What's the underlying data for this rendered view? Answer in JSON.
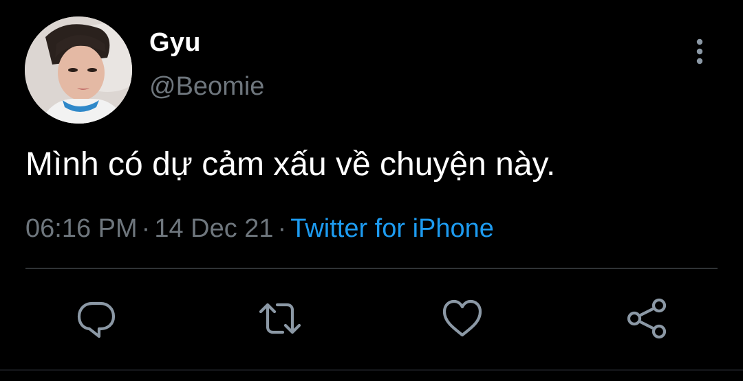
{
  "user": {
    "display_name": "Gyu",
    "handle": "@Beomie",
    "avatar_icon": "profile-photo"
  },
  "tweet": {
    "text": "Mình có dự cảm xấu về chuyện này.",
    "time": "06:16 PM",
    "separator": "·",
    "date": "14 Dec 21",
    "source": "Twitter for iPhone"
  },
  "header": {
    "more_icon": "more-vertical-icon"
  },
  "actions": [
    {
      "name": "reply",
      "icon": "reply-icon"
    },
    {
      "name": "retweet",
      "icon": "retweet-icon"
    },
    {
      "name": "like",
      "icon": "heart-icon"
    },
    {
      "name": "share",
      "icon": "share-icon"
    }
  ],
  "colors": {
    "background": "#000000",
    "primary_text": "#ffffff",
    "secondary_text": "#6e767d",
    "accent": "#1d9bf0",
    "divider": "#2f3336",
    "icon": "#8b98a5"
  }
}
